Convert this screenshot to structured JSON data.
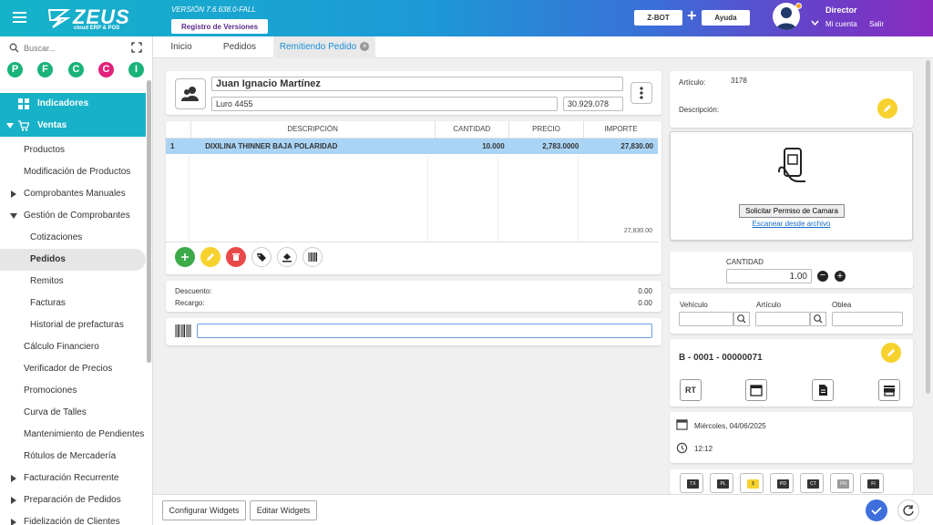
{
  "header": {
    "logo_text": "ZEUS",
    "logo_sub": "cloud ERP & POS",
    "version": "VERSIÓN 7.6.638.0-FALL",
    "registro_label": "Registro de Versiones",
    "zbot_label": "Z-BOT",
    "ayuda_label": "Ayuda",
    "user_name": "Director",
    "mi_cuenta": "Mi cuenta",
    "salir": "Salir"
  },
  "sidebar": {
    "search_placeholder": "Buscar...",
    "shortcuts": [
      {
        "letter": "P",
        "color": "#1ab37a"
      },
      {
        "letter": "F",
        "color": "#1ab37a"
      },
      {
        "letter": "C",
        "color": "#1ab37a"
      },
      {
        "letter": "C",
        "color": "#e0227a"
      },
      {
        "letter": "I",
        "color": "#1ab37a"
      }
    ],
    "items": [
      "Indicadores",
      "Ventas",
      "Productos",
      "Modificación de Productos",
      "Comprobantes Manuales",
      "Gestión de Comprobantes",
      "Cotizaciones",
      "Pedidos",
      "Remitos",
      "Facturas",
      "Historial de prefacturas",
      "Cálculo Financiero",
      "Verificador de Precios",
      "Promociones",
      "Curva de Talles",
      "Mantenimiento de Pendientes",
      "Rótulos de Mercadería",
      "Facturación Recurrente",
      "Preparación de Pedidos",
      "Fidelización de Clientes"
    ]
  },
  "tabs": [
    "Inicio",
    "Pedidos",
    "Remitiendo Pedido"
  ],
  "customer": {
    "name": "Juan Ignacio Martínez",
    "address": "Luro 4455",
    "doc": "30.929.078"
  },
  "table": {
    "headers": [
      "DESCRIPCIÓN",
      "CANTIDAD",
      "PRECIO",
      "IMPORTE"
    ],
    "rows": [
      {
        "n": "1",
        "desc": "DIXILINA THINNER BAJA POLARIDAD",
        "qty": "10.000",
        "price": "2,783.0000",
        "total": "27,830.00"
      }
    ],
    "footer_total": "27,830.00"
  },
  "totals": {
    "descuento_label": "Descuento:",
    "descuento_value": "0.00",
    "recargo_label": "Recargo:",
    "recargo_value": "0.00"
  },
  "right": {
    "articulo_label": "Artículo:",
    "articulo_value": "3178",
    "descripcion_label": "Descripción:",
    "camera_btn": "Solicitar Permiso de Camara",
    "scan_link": "Escanear desde archivo",
    "cantidad_label": "CANTIDAD",
    "cantidad_value": "1.00",
    "vehiculo_label": "Vehículo",
    "articulo2_label": "Artículo",
    "oblea_label": "Oblea",
    "comprobante": "B - 0001 - 00000071",
    "rt_label": "RT",
    "fecha": "Miércoles, 04/06/2025",
    "hora": "12:12",
    "chips": [
      "TX",
      "PL",
      "$",
      "PD",
      "CT",
      "FN",
      "FI"
    ]
  },
  "bottom": {
    "configurar": "Configurar Widgets",
    "editar": "Editar Widgets"
  },
  "colors": {
    "accent": "#18b2c8",
    "selected_row": "#aad4f5",
    "green": "#3daa4a",
    "yellow": "#f7d22e",
    "red": "#e84a4a",
    "blue": "#3f6fdc"
  }
}
